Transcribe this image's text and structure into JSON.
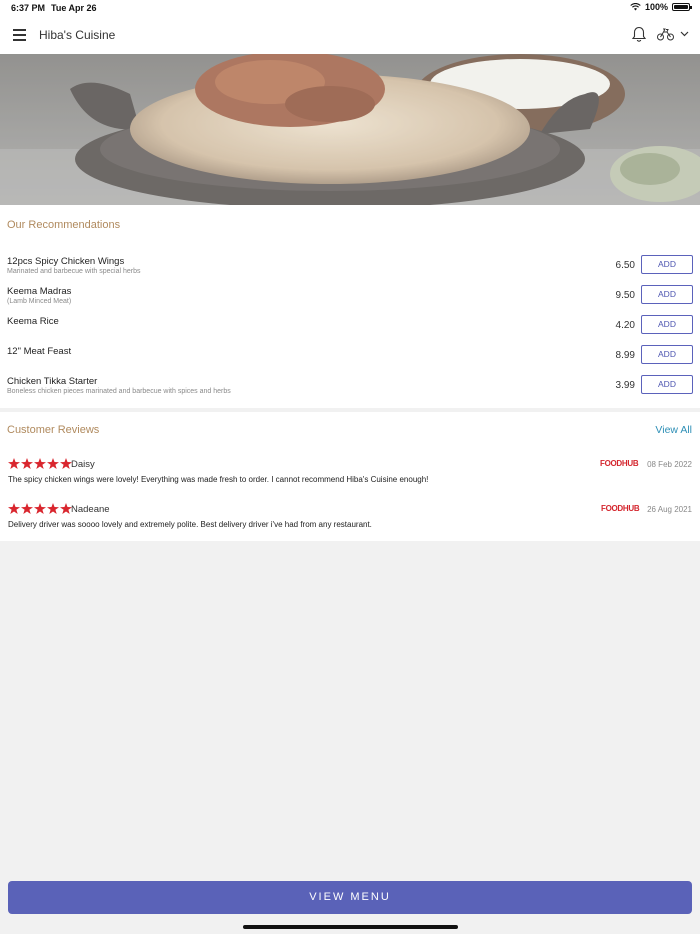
{
  "status_bar": {
    "time": "6:37 PM",
    "date": "Tue Apr 26",
    "battery": "100%"
  },
  "header": {
    "title": "Hiba's Cuisine"
  },
  "recommendations": {
    "title": "Our Recommendations",
    "items": [
      {
        "name": "12pcs Spicy Chicken Wings",
        "description": "Marinated and barbecue with special herbs",
        "price": "6.50",
        "button": "ADD"
      },
      {
        "name": "Keema Madras",
        "description": "(Lamb Minced Meat)",
        "price": "9.50",
        "button": "ADD"
      },
      {
        "name": "Keema Rice",
        "description": "",
        "price": "4.20",
        "button": "ADD"
      },
      {
        "name": "12\" Meat Feast",
        "description": "",
        "price": "8.99",
        "button": "ADD"
      },
      {
        "name": "Chicken Tikka Starter",
        "description": "Boneless chicken pieces marinated and barbecue with spices and herbs",
        "price": "3.99",
        "button": "ADD"
      }
    ]
  },
  "reviews": {
    "title": "Customer Reviews",
    "view_all": "View All",
    "items": [
      {
        "name": "Daisy",
        "stars": 5,
        "source": "FOODHUB",
        "date": "08 Feb 2022",
        "text": "The spicy chicken wings were lovely! Everything was made fresh to order. I cannot recommend Hiba's Cuisine enough!"
      },
      {
        "name": "Nadeane",
        "stars": 5,
        "source": "FOODHUB",
        "date": "26 Aug 2021",
        "text": "Delivery driver was soooo lovely and extremely polite. Best delivery driver i've had from any restaurant."
      }
    ]
  },
  "footer": {
    "button": "VIEW MENU"
  },
  "colors": {
    "accent": "#5a62b8",
    "section_title": "#b08a5e",
    "star": "#d9262e",
    "link": "#2e8fb6"
  }
}
